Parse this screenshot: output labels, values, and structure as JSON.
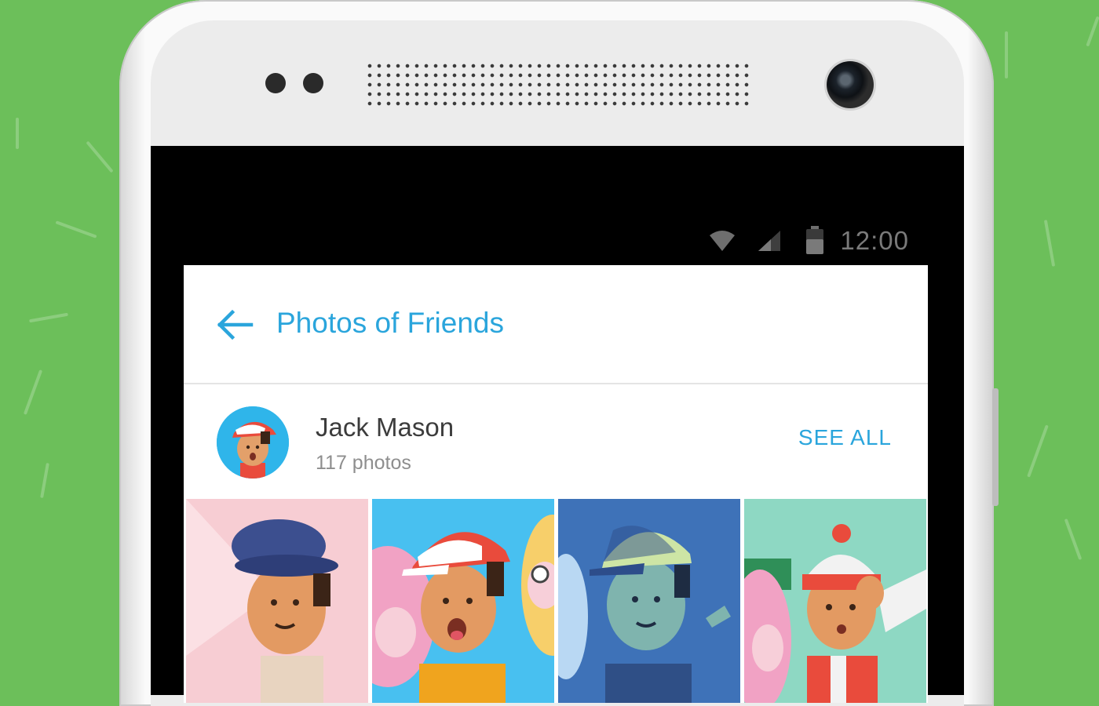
{
  "status_bar": {
    "time": "12:00"
  },
  "app_bar": {
    "title": "Photos of Friends",
    "back_icon": "arrow-left-icon"
  },
  "friend": {
    "name": "Jack Mason",
    "photo_count": "117 photos",
    "see_all_label": "SEE ALL"
  },
  "photos": [
    {
      "subject": "boy in navy bucket hat"
    },
    {
      "subject": "boy in red OK cap"
    },
    {
      "subject": "boy in green cap"
    },
    {
      "subject": "boy in red beanie with scarf"
    }
  ],
  "colors": {
    "background": "#6cbf5a",
    "accent": "#2aa5dc",
    "phone_body": "#fafafa"
  }
}
